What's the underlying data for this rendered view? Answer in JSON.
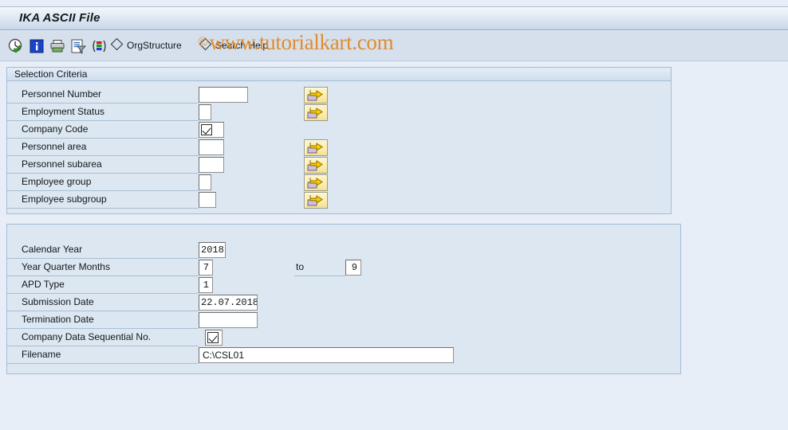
{
  "window": {
    "title": "IKA ASCII File"
  },
  "toolbar": {
    "icons": [
      {
        "name": "execute-clock-check-icon",
        "title": "Execute"
      },
      {
        "name": "information-icon",
        "title": "Information"
      },
      {
        "name": "print-icon",
        "title": "Print"
      },
      {
        "name": "document-filter-icon",
        "title": "Get Variant"
      },
      {
        "name": "multicolor-variant-icon",
        "title": "Variant"
      }
    ],
    "items": [
      {
        "name": "orgstructure",
        "label": "OrgStructure"
      },
      {
        "name": "search-help",
        "label": "Search Help"
      }
    ]
  },
  "watermark": {
    "copyright": "©",
    "text": "www.tutorialkart.com"
  },
  "selection_panel": {
    "header": "Selection Criteria",
    "rows": [
      {
        "name": "personnel-number",
        "label": "Personnel Number",
        "value": "",
        "field_width": 62,
        "type": "text",
        "has_arrow": true
      },
      {
        "name": "employment-status",
        "label": "Employment Status",
        "value": "",
        "field_width": 16,
        "type": "text",
        "has_arrow": true
      },
      {
        "name": "company-code",
        "label": "Company Code",
        "value": "",
        "field_width": 32,
        "type": "checkbox",
        "has_arrow": false,
        "checked": true
      },
      {
        "name": "personnel-area",
        "label": "Personnel area",
        "value": "",
        "field_width": 32,
        "type": "text",
        "has_arrow": true
      },
      {
        "name": "personnel-subarea",
        "label": "Personnel subarea",
        "value": "",
        "field_width": 32,
        "type": "text",
        "has_arrow": true
      },
      {
        "name": "employee-group",
        "label": "Employee group",
        "value": "",
        "field_width": 16,
        "type": "text",
        "has_arrow": true
      },
      {
        "name": "employee-subgroup",
        "label": "Employee subgroup",
        "value": "",
        "field_width": 22,
        "type": "text",
        "has_arrow": true
      }
    ]
  },
  "parameters_panel": {
    "header": "",
    "to_label": "to",
    "rows": [
      {
        "name": "calendar-year",
        "label": "Calendar Year",
        "value": "2018",
        "field_width": 34,
        "type": "num"
      },
      {
        "name": "year-quarter-months",
        "label": "Year Quarter Months",
        "value": "7",
        "field_width": 18,
        "type": "num",
        "second": {
          "name": "year-quarter-months-to",
          "value": "9",
          "field_width": 20
        }
      },
      {
        "name": "apd-type",
        "label": "APD Type",
        "value": "1",
        "field_width": 18,
        "type": "num"
      },
      {
        "name": "submission-date",
        "label": "Submission Date",
        "value": "22.07.2018",
        "field_width": 74,
        "type": "date"
      },
      {
        "name": "termination-date",
        "label": "Termination Date",
        "value": "",
        "field_width": 74,
        "type": "date"
      },
      {
        "name": "company-data-seq-no",
        "label": "Company Data Sequential No.",
        "value": "",
        "field_width": 22,
        "type": "checkbox",
        "checked": true
      },
      {
        "name": "filename",
        "label": "Filename",
        "value": "C:\\CSL01",
        "field_width": 320,
        "type": "txt"
      }
    ]
  },
  "colors": {
    "canvas": "#e8eef7",
    "panel_bg": "#dde7f1",
    "panel_border": "#a3bcd6",
    "titlebar_end": "#c6d7e9",
    "toolbar_bg": "#d6e0ec",
    "watermark": "#e08c2e",
    "button_yellow": "#fbeeae",
    "arrow_gold": "#ffcc00"
  }
}
